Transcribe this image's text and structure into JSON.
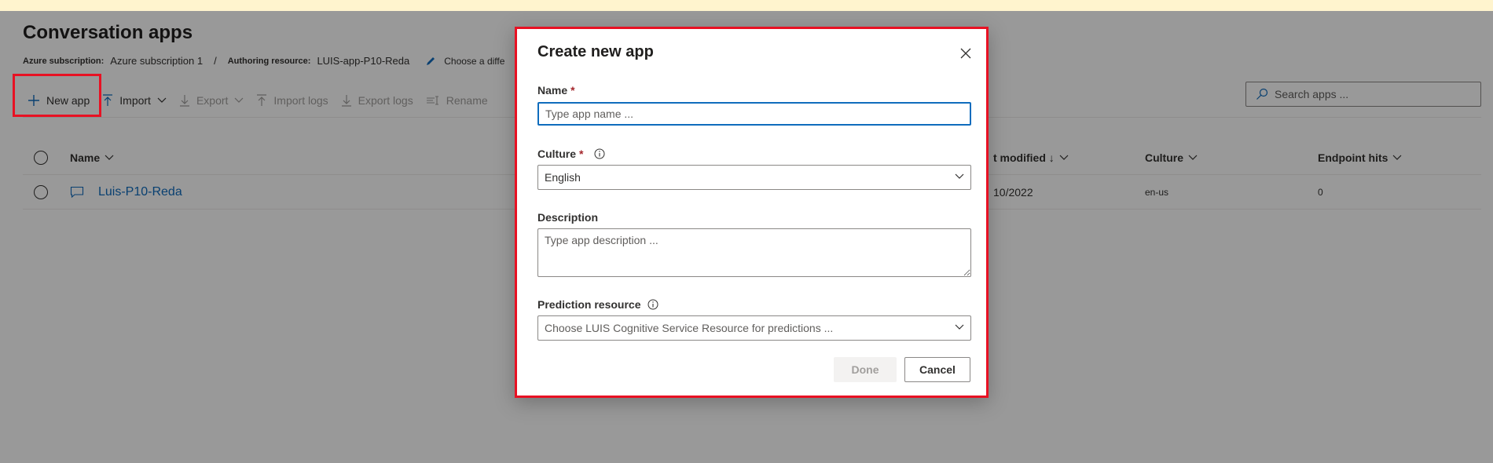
{
  "page": {
    "title": "Conversation apps",
    "subscription_label": "Azure subscription:",
    "subscription_value": "Azure subscription 1",
    "separator": "/",
    "resource_label": "Authoring resource:",
    "resource_value": "LUIS-app-P10-Reda",
    "edit_label": "Choose a diffe"
  },
  "toolbar": {
    "new_app": "New app",
    "import": "Import",
    "export": "Export",
    "import_logs": "Import logs",
    "export_logs": "Export logs",
    "rename": "Rename"
  },
  "search": {
    "placeholder": "Search apps ..."
  },
  "table": {
    "columns": [
      "Name",
      "t modified ↓",
      "Culture",
      "Endpoint hits"
    ],
    "rows": [
      {
        "name": "Luis-P10-Reda",
        "modified": "10/2022",
        "culture": "en-us",
        "endpoint_hits": "0"
      }
    ]
  },
  "dialog": {
    "title": "Create new app",
    "name_label": "Name",
    "required_mark": "*",
    "name_placeholder": "Type app name ...",
    "culture_label": "Culture",
    "culture_value": "English",
    "description_label": "Description",
    "description_placeholder": "Type app description ...",
    "prediction_label": "Prediction resource",
    "prediction_placeholder": "Choose LUIS Cognitive Service Resource for predictions ...",
    "done": "Done",
    "cancel": "Cancel"
  },
  "colors": {
    "accent": "#0f6cbd",
    "highlight": "#e81123",
    "required": "#a4262c",
    "top_strip": "#fff4ce"
  }
}
